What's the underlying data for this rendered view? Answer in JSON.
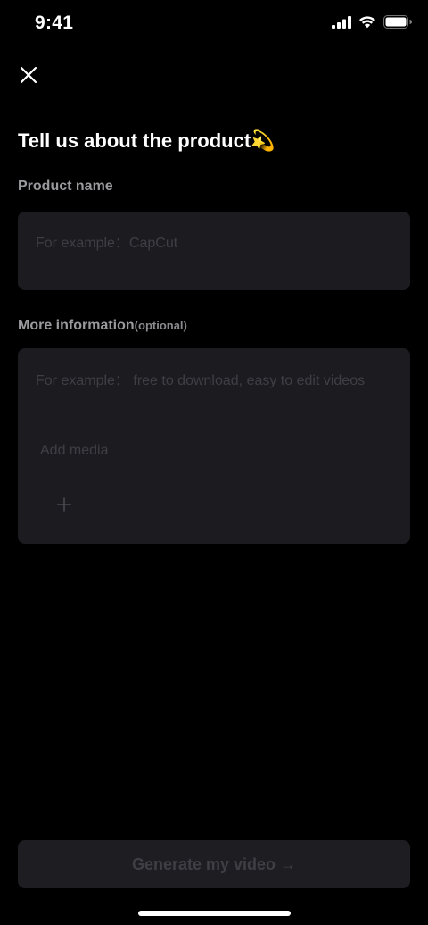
{
  "status_bar": {
    "time": "9:41"
  },
  "header": {
    "close_icon": "close-icon"
  },
  "page": {
    "title": "Tell us about the product💫"
  },
  "product_name": {
    "label": "Product name",
    "placeholder": "For example：CapCut",
    "value": ""
  },
  "more_info": {
    "label": "More information",
    "optional_label": "(optional)",
    "placeholder": "For example： free to download, easy to edit videos",
    "value": "",
    "add_media_label": "Add media",
    "add_media_icon": "plus-icon"
  },
  "footer": {
    "generate_label": "Generate my video →"
  },
  "colors": {
    "background": "#000000",
    "field_background": "#1c1c20",
    "label": "#9a9a9e",
    "placeholder": "#3e3e44",
    "button_background": "#1e1e22"
  }
}
